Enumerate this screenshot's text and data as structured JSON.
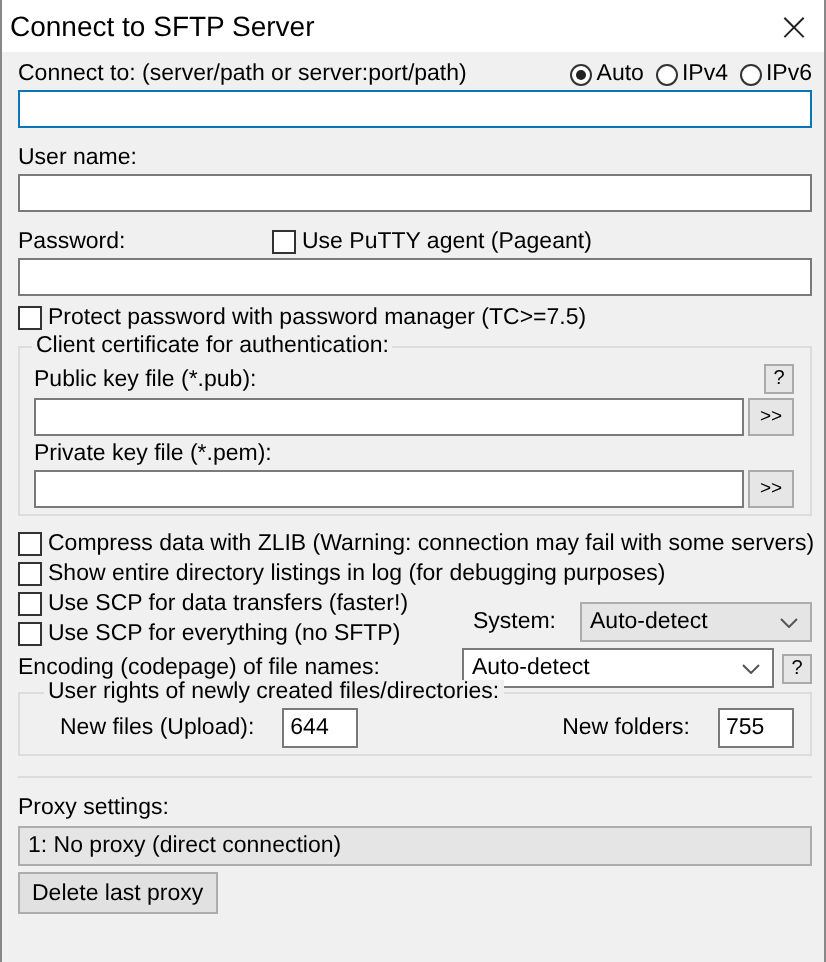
{
  "window": {
    "title": "Connect to SFTP Server",
    "close": "×"
  },
  "connect": {
    "label": "Connect to: (server/path or server:port/path)",
    "ip_options": [
      {
        "label": "Auto",
        "selected": true
      },
      {
        "label": "IPv4",
        "selected": false
      },
      {
        "label": "IPv6",
        "selected": false
      }
    ]
  },
  "user": {
    "label": "User name:"
  },
  "password": {
    "label": "Password:",
    "pageant": {
      "label": "Use PuTTY agent (Pageant)",
      "checked": false
    }
  },
  "protect": {
    "label": "Protect password with password manager (TC>=7.5)",
    "checked": false
  },
  "certificate": {
    "title": "Client certificate for authentication:",
    "help": "?",
    "public": {
      "label": "Public key file (*.pub):",
      "browse": ">>"
    },
    "private": {
      "label": "Private key file (*.pem):",
      "browse": ">>"
    }
  },
  "options": [
    {
      "label": "Compress data with ZLIB (Warning: connection may fail with some servers)",
      "checked": false
    },
    {
      "label": "Show entire directory listings in log (for debugging purposes)",
      "checked": false
    },
    {
      "label": "Use SCP for data transfers (faster!)",
      "checked": false
    },
    {
      "label": "Use SCP for everything (no SFTP)",
      "checked": false
    }
  ],
  "system": {
    "label": "System:",
    "value": "Auto-detect"
  },
  "encoding": {
    "label": "Encoding (codepage) of file names:",
    "value": "Auto-detect",
    "help": "?"
  },
  "rights": {
    "title": "User rights of newly created files/directories:",
    "files_label": "New files (Upload):",
    "files_value": "644",
    "folders_label": "New folders:",
    "folders_value": "755"
  },
  "proxy": {
    "label": "Proxy settings:",
    "value": "1: No proxy (direct connection)",
    "delete": "Delete last proxy"
  }
}
